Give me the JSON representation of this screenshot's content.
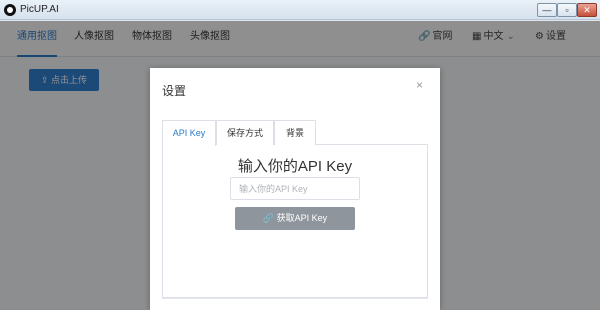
{
  "window": {
    "title": "PicUP.AI",
    "minimize_glyph": "—",
    "maximize_glyph": "▫",
    "close_glyph": "✕"
  },
  "nav": {
    "tabs": [
      {
        "label": "通用抠图",
        "active": true
      },
      {
        "label": "人像抠图",
        "active": false
      },
      {
        "label": "物体抠图",
        "active": false
      },
      {
        "label": "头像抠图",
        "active": false
      }
    ],
    "official_site": "官网",
    "language": "中文",
    "settings": "设置",
    "icons": {
      "site": "link-icon",
      "language": "translate-icon",
      "settings": "gear-icon",
      "dropdown": "chevron-down-icon"
    }
  },
  "main": {
    "upload_label": "点击上传"
  },
  "dialog": {
    "title": "设置",
    "close_glyph": "×",
    "tabs": [
      {
        "label": "API Key",
        "active": true
      },
      {
        "label": "保存方式",
        "active": false
      },
      {
        "label": "背景",
        "active": false
      }
    ],
    "heading": "输入你的API Key",
    "input_placeholder": "输入你的API Key",
    "input_value": "",
    "get_key_label": "获取API Key"
  },
  "colors": {
    "accent": "#2a7bc8",
    "upload_button": "#2f80d1",
    "get_key_button": "#8f959c"
  }
}
